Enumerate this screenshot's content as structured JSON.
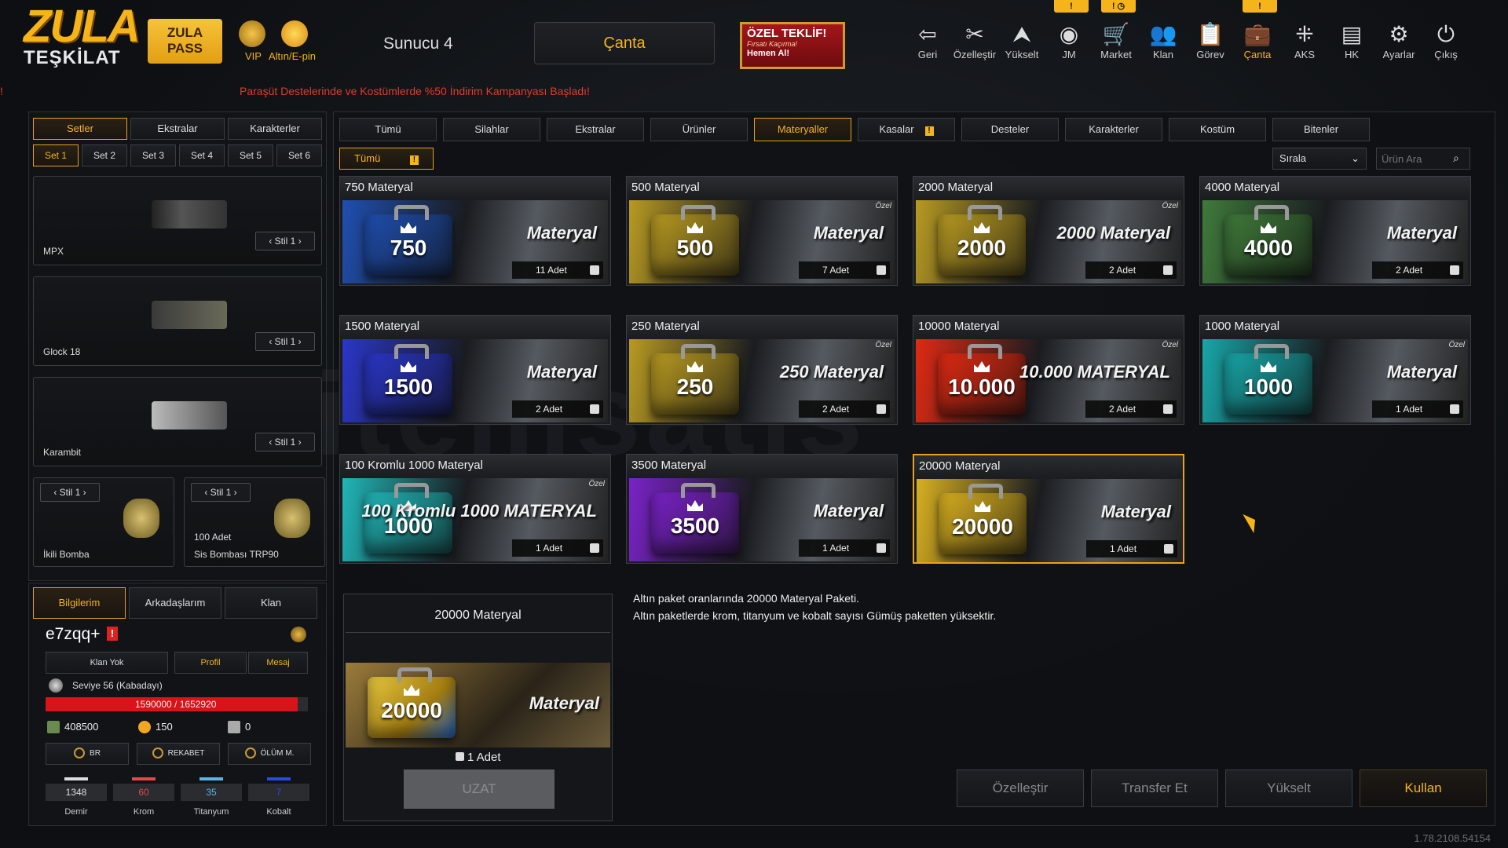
{
  "header": {
    "logo_top": "ZULA",
    "logo_bottom": "TEŞKİLAT",
    "zula_pass_line1": "ZULA",
    "zula_pass_line2": "PASS",
    "vip_label": "VIP",
    "altin_label": "Altın/E-pin",
    "server": "Sunucu 4",
    "canta_button": "Çanta",
    "offer": {
      "title": "ÖZEL TEKLİF!",
      "subtitle": "Fırsatı Kaçırma!",
      "cta": "Hemen Al!"
    },
    "nav": [
      {
        "label": "Geri",
        "icon": "back-icon",
        "glyph": "⇦"
      },
      {
        "label": "Özelleştir",
        "icon": "tools-icon",
        "glyph": "✂"
      },
      {
        "label": "Yükselt",
        "icon": "upgrade-icon",
        "glyph": "⮝"
      },
      {
        "label": "JM",
        "icon": "coins-icon",
        "glyph": "◉"
      },
      {
        "label": "Market",
        "icon": "cart-icon",
        "glyph": "🛒"
      },
      {
        "label": "Klan",
        "icon": "clan-icon",
        "glyph": "👥"
      },
      {
        "label": "Görev",
        "icon": "clipboard-icon",
        "glyph": "📋"
      },
      {
        "label": "Çanta",
        "icon": "bag-icon",
        "glyph": "💼"
      },
      {
        "label": "AKS",
        "icon": "network-icon",
        "glyph": "⁜"
      },
      {
        "label": "HK",
        "icon": "wallet-icon",
        "glyph": "▤"
      },
      {
        "label": "Ayarlar",
        "icon": "gear-icon",
        "glyph": "⚙"
      },
      {
        "label": "Çıkış",
        "icon": "power-icon",
        "glyph": "⏻"
      }
    ],
    "badges": [
      "!",
      "! ◷",
      "!"
    ]
  },
  "campaign": "Paraşüt Destelerinde ve Kostümlerde %50 İndirim Kampanyası Başladı!",
  "left": {
    "tabs": [
      "Setler",
      "Ekstralar",
      "Karakterler"
    ],
    "sets": [
      "Set 1",
      "Set 2",
      "Set 3",
      "Set 4",
      "Set 5",
      "Set 6"
    ],
    "weapons": [
      {
        "name": "MPX",
        "style": "Stil 1"
      },
      {
        "name": "Glock 18",
        "style": "Stil 1"
      },
      {
        "name": "Karambit",
        "style": "Stil 1"
      }
    ],
    "small": [
      {
        "name": "İkili Bomba",
        "style": "Stil 1",
        "count": ""
      },
      {
        "name": "Sis Bombası TRP90",
        "style": "Stil 1",
        "count": "100 Adet"
      }
    ]
  },
  "info": {
    "tabs": [
      "Bilgilerim",
      "Arkadaşlarım",
      "Klan"
    ],
    "username": "e7zqq+",
    "buttons": [
      "Klan Yok",
      "Profil",
      "Mesaj"
    ],
    "level": "Seviye 56 (Kabadayı)",
    "xp": "1590000 / 1652920",
    "xp_fraction": 0.96,
    "currency": [
      {
        "icon": "z-icon",
        "value": "408500"
      },
      {
        "icon": "gold-coin-icon",
        "value": "150"
      },
      {
        "icon": "hp-icon",
        "value": "0"
      }
    ],
    "modes": [
      "BR",
      "REKABET",
      "ÖLÜM M."
    ],
    "materials": [
      {
        "name": "Demir",
        "value": "1348",
        "color": "#dddddd"
      },
      {
        "name": "Krom",
        "value": "60",
        "color": "#e04a4a"
      },
      {
        "name": "Titanyum",
        "value": "35",
        "color": "#5ab6e6"
      },
      {
        "name": "Kobalt",
        "value": "7",
        "color": "#2a4ae0"
      }
    ]
  },
  "filters": [
    "Tümü",
    "Silahlar",
    "Ekstralar",
    "Ürünler",
    "Materyaller",
    "Kasalar",
    "Desteler",
    "Karakterler",
    "Kostüm",
    "Bitenler"
  ],
  "subfilter": "Tümü",
  "sort_label": "Sırala",
  "search_placeholder": "Ürün Ara",
  "items": [
    {
      "title": "750 Materyal",
      "num": "750",
      "label": "Materyal",
      "count": "11 Adet",
      "color": "#1f4fb0",
      "ozel": ""
    },
    {
      "title": "500 Materyal",
      "num": "500",
      "label": "Materyal",
      "count": "7 Adet",
      "color": "#b89a22",
      "ozel": "Özel"
    },
    {
      "title": "2000 Materyal",
      "num": "2000",
      "label": "2000 Materyal",
      "count": "2 Adet",
      "color": "#b89a22",
      "ozel": "Özel"
    },
    {
      "title": "4000 Materyal",
      "num": "4000",
      "label": "Materyal",
      "count": "2 Adet",
      "color": "#3f7a3a",
      "ozel": ""
    },
    {
      "title": "1500 Materyal",
      "num": "1500",
      "label": "Materyal",
      "count": "2 Adet",
      "color": "#2a36c8",
      "ozel": ""
    },
    {
      "title": "250 Materyal",
      "num": "250",
      "label": "250 Materyal",
      "count": "2 Adet",
      "color": "#b89a22",
      "ozel": "Özel"
    },
    {
      "title": "10000 Materyal",
      "num": "10.000",
      "label": "10.000 MATERYAL",
      "count": "2 Adet",
      "color": "#e02a12",
      "ozel": "Özel"
    },
    {
      "title": "1000 Materyal",
      "num": "1000",
      "label": "Materyal",
      "count": "1 Adet",
      "color": "#18a6a8",
      "ozel": "Özel"
    },
    {
      "title": "100 Kromlu 1000 Materyal",
      "num": "1000",
      "label": "100 Kromlu 1000 MATERYAL",
      "count": "1 Adet",
      "color": "#20b6b8",
      "ozel": "Özel"
    },
    {
      "title": "3500 Materyal",
      "num": "3500",
      "label": "Materyal",
      "count": "1 Adet",
      "color": "#7a22c8",
      "ozel": ""
    },
    {
      "title": "20000 Materyal",
      "num": "20000",
      "label": "Materyal",
      "count": "1 Adet",
      "color": "#d8b020",
      "ozel": ""
    }
  ],
  "detail": {
    "title": "20000 Materyal",
    "num": "20000",
    "label": "Materyal",
    "count": "1 Adet",
    "extend": "UZAT",
    "desc1": "Altın paket oranlarında 20000 Materyal Paketi.",
    "desc2": "Altın paketlerde krom, titanyum ve kobalt sayısı Gümüş paketten yüksektir."
  },
  "actions": [
    "Özelleştir",
    "Transfer Et",
    "Yükselt",
    "Kullan"
  ],
  "watermark": "itemsatis",
  "version": "1.78.2108.54154",
  "colors": {
    "accent": "#f5b41a",
    "red": "#e23b2e"
  }
}
